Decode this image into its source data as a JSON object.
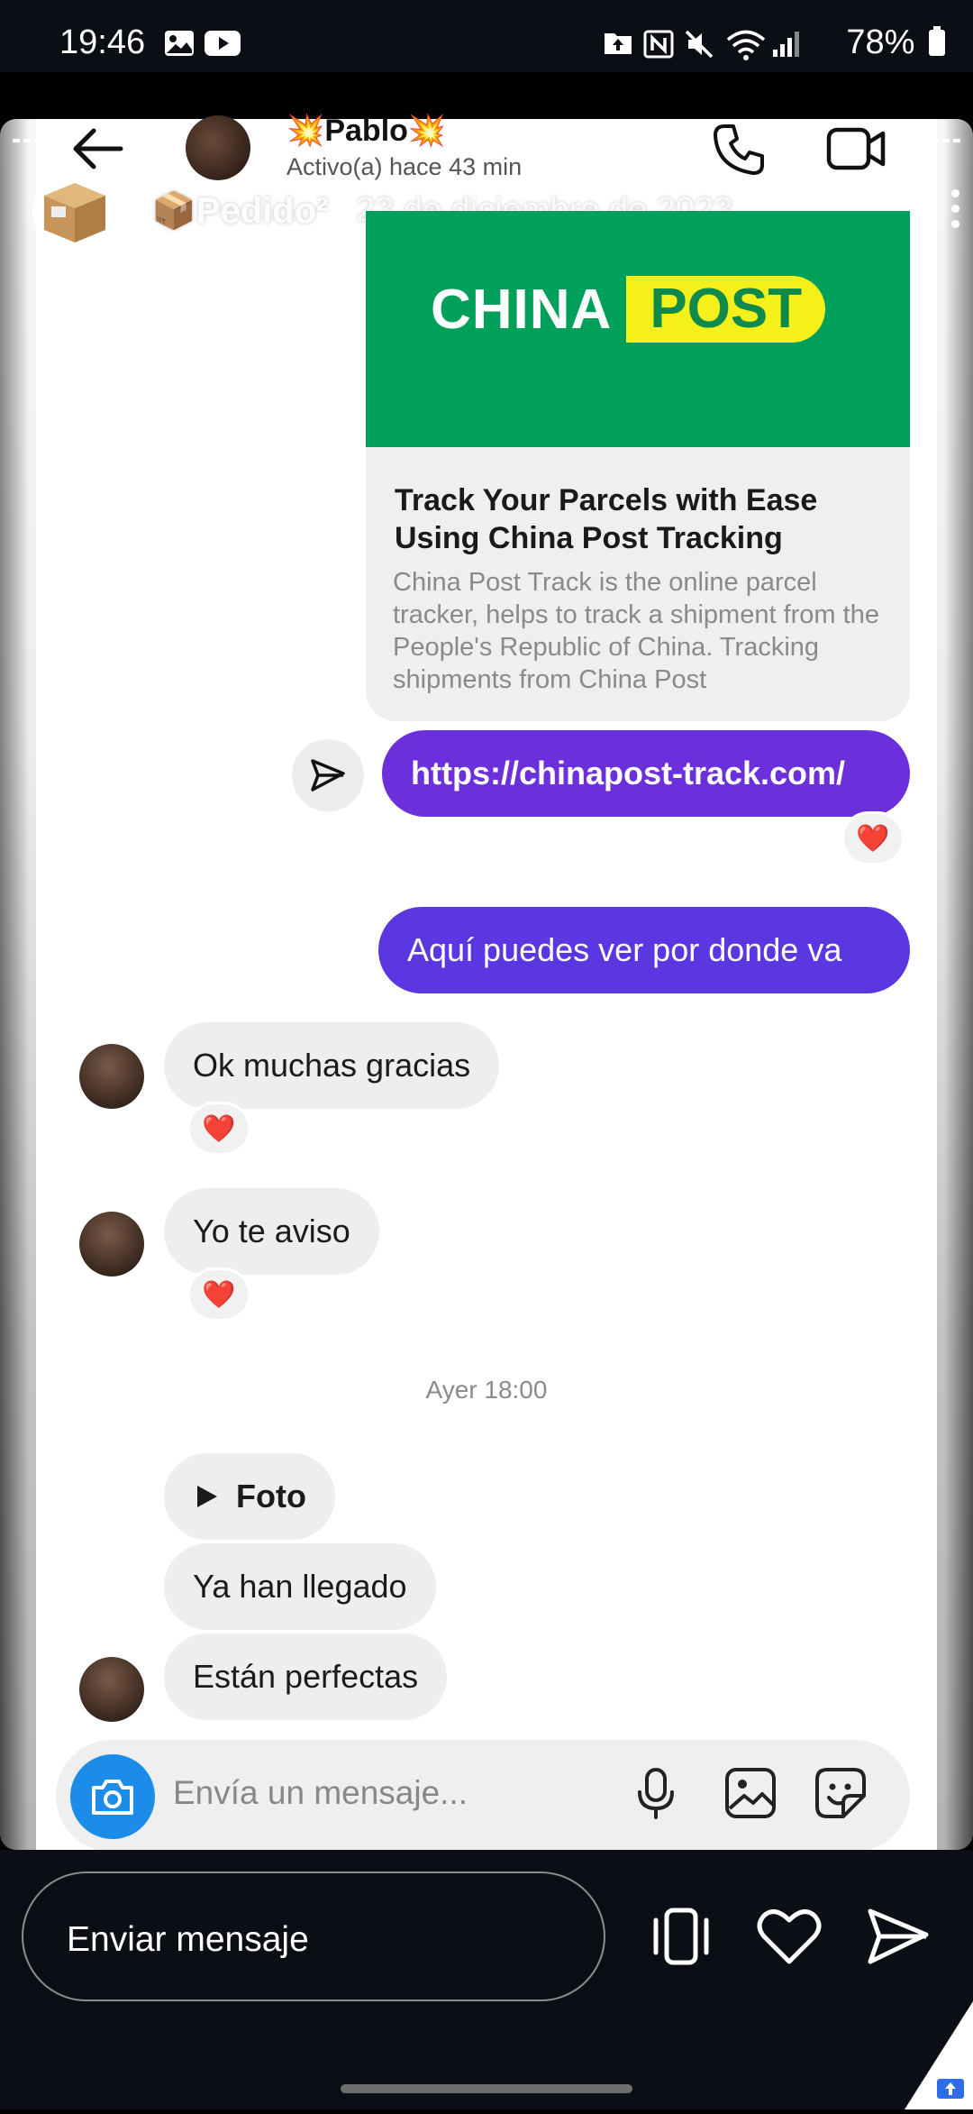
{
  "status_bar": {
    "time": "19:46",
    "battery": "78%"
  },
  "chat_header": {
    "contact_name": "💥Pablo💥",
    "contact_status": "Activo(a) hace 43 min"
  },
  "story_header": {
    "title": "📦Pedido²",
    "date": "23 de diciembre de 2023"
  },
  "link_preview": {
    "logo_left": "CHINA",
    "logo_right": "POST",
    "title": "Track Your Parcels with Ease Using China Post Tracking",
    "description": "China Post Track is the online parcel tracker, helps to track a shipment from the People's Republic of China. Tracking shipments from China Post"
  },
  "messages": {
    "link": "https://chinapost-track.com/",
    "outgoing_text": "Aquí puedes ver por donde va",
    "reply_1": "Ok muchas gracias",
    "reply_2": "Yo te aviso",
    "timestamp": "Ayer 18:00",
    "photo_label": "Foto",
    "reply_3": "Ya han llegado",
    "reply_4": "Están perfectas",
    "reaction": "❤️"
  },
  "composer": {
    "placeholder": "Envía un mensaje..."
  },
  "bottom_bar": {
    "send_message": "Enviar mensaje"
  },
  "colors": {
    "link_bubble": "#6c2fdc",
    "text_bubble": "#5a37e0",
    "camera_button": "#1b8de8",
    "china_post_green": "#00a05a",
    "china_post_yellow": "#f6f01a"
  }
}
